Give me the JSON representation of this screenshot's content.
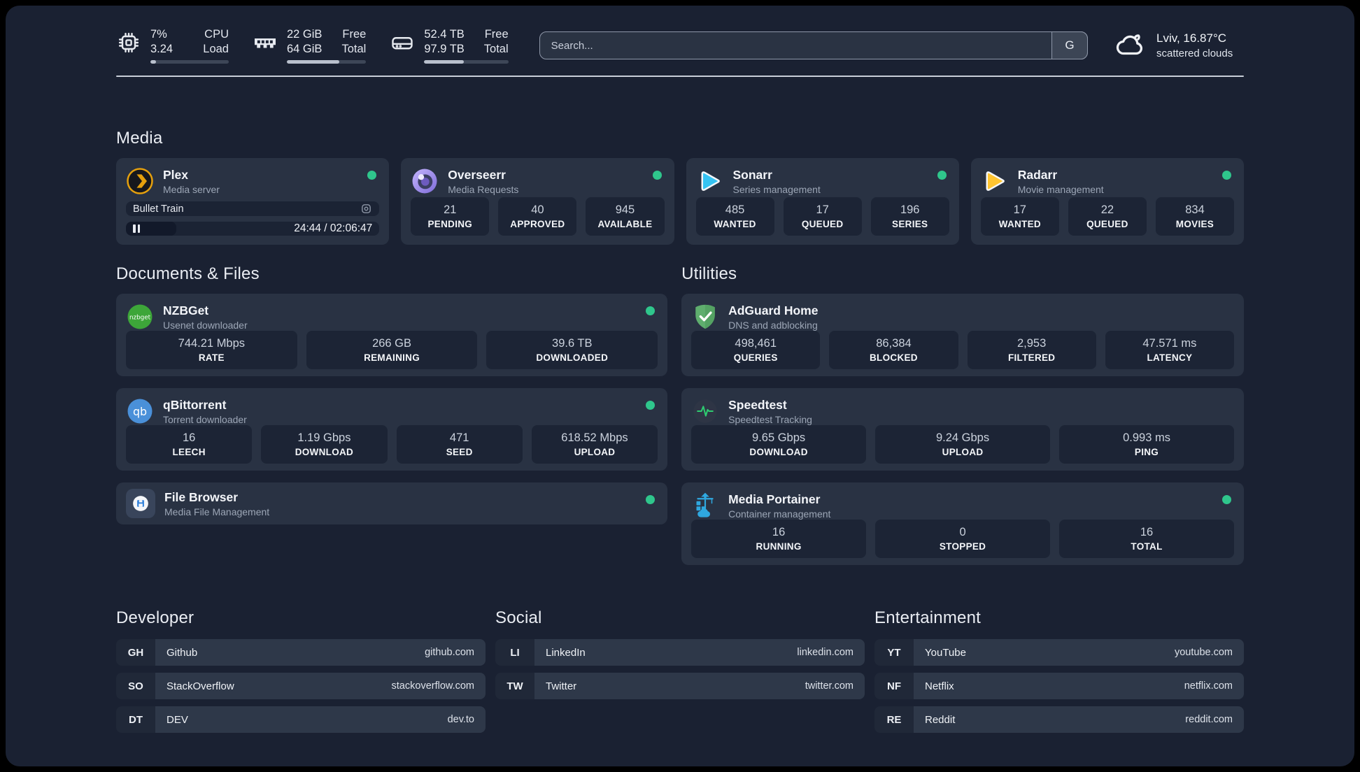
{
  "topbar": {
    "monitors": [
      {
        "icon": "cpu-icon",
        "value_top": "7%",
        "value_bottom": "3.24",
        "label_top": "CPU",
        "label_bottom": "Load",
        "progress_pct": 7
      },
      {
        "icon": "memory-icon",
        "value_top": "22 GiB",
        "value_bottom": "64 GiB",
        "label_top": "Free",
        "label_bottom": "Total",
        "progress_pct": 66
      },
      {
        "icon": "disk-icon",
        "value_top": "52.4 TB",
        "value_bottom": "97.9 TB",
        "label_top": "Free",
        "label_bottom": "Total",
        "progress_pct": 47
      }
    ],
    "search": {
      "placeholder": "Search...",
      "engine_button": "G"
    },
    "weather": {
      "icon": "cloud-icon",
      "title": "Lviv, 16.87°C",
      "subtitle": "scattered clouds"
    }
  },
  "sections": {
    "media": {
      "title": "Media",
      "plex": {
        "name": "Plex",
        "description": "Media server",
        "status": "online",
        "now_playing": "Bullet Train",
        "state": "paused",
        "time_display": "24:44 / 02:06:47",
        "progress_pct": 20
      },
      "overseerr": {
        "name": "Overseerr",
        "description": "Media Requests",
        "status": "online",
        "stats": [
          {
            "value": "21",
            "label": "PENDING"
          },
          {
            "value": "40",
            "label": "APPROVED"
          },
          {
            "value": "945",
            "label": "AVAILABLE"
          }
        ]
      },
      "sonarr": {
        "name": "Sonarr",
        "description": "Series management",
        "status": "online",
        "stats": [
          {
            "value": "485",
            "label": "WANTED"
          },
          {
            "value": "17",
            "label": "QUEUED"
          },
          {
            "value": "196",
            "label": "SERIES"
          }
        ]
      },
      "radarr": {
        "name": "Radarr",
        "description": "Movie management",
        "status": "online",
        "stats": [
          {
            "value": "17",
            "label": "WANTED"
          },
          {
            "value": "22",
            "label": "QUEUED"
          },
          {
            "value": "834",
            "label": "MOVIES"
          }
        ]
      }
    },
    "documents": {
      "title": "Documents & Files",
      "nzbget": {
        "name": "NZBGet",
        "description": "Usenet downloader",
        "status": "online",
        "stats": [
          {
            "value": "744.21 Mbps",
            "label": "RATE"
          },
          {
            "value": "266 GB",
            "label": "REMAINING"
          },
          {
            "value": "39.6 TB",
            "label": "DOWNLOADED"
          }
        ]
      },
      "qbittorrent": {
        "name": "qBittorrent",
        "description": "Torrent downloader",
        "status": "online",
        "stats": [
          {
            "value": "16",
            "label": "LEECH"
          },
          {
            "value": "1.19 Gbps",
            "label": "DOWNLOAD"
          },
          {
            "value": "471",
            "label": "SEED"
          },
          {
            "value": "618.52 Mbps",
            "label": "UPLOAD"
          }
        ]
      },
      "filebrowser": {
        "name": "File Browser",
        "description": "Media File Management",
        "status": "online"
      }
    },
    "utilities": {
      "title": "Utilities",
      "adguard": {
        "name": "AdGuard Home",
        "description": "DNS and adblocking",
        "stats": [
          {
            "value": "498,461",
            "label": "QUERIES"
          },
          {
            "value": "86,384",
            "label": "BLOCKED"
          },
          {
            "value": "2,953",
            "label": "FILTERED"
          },
          {
            "value": "47.571 ms",
            "label": "LATENCY"
          }
        ]
      },
      "speedtest": {
        "name": "Speedtest",
        "description": "Speedtest Tracking",
        "stats": [
          {
            "value": "9.65 Gbps",
            "label": "DOWNLOAD"
          },
          {
            "value": "9.24 Gbps",
            "label": "UPLOAD"
          },
          {
            "value": "0.993 ms",
            "label": "PING"
          }
        ]
      },
      "portainer": {
        "name": "Media Portainer",
        "description": "Container management",
        "status": "online",
        "stats": [
          {
            "value": "16",
            "label": "RUNNING"
          },
          {
            "value": "0",
            "label": "STOPPED"
          },
          {
            "value": "16",
            "label": "TOTAL"
          }
        ]
      }
    },
    "links": [
      {
        "title": "Developer",
        "items": [
          {
            "abbr": "GH",
            "name": "Github",
            "url": "github.com"
          },
          {
            "abbr": "SO",
            "name": "StackOverflow",
            "url": "stackoverflow.com"
          },
          {
            "abbr": "DT",
            "name": "DEV",
            "url": "dev.to"
          }
        ]
      },
      {
        "title": "Social",
        "items": [
          {
            "abbr": "LI",
            "name": "LinkedIn",
            "url": "linkedin.com"
          },
          {
            "abbr": "TW",
            "name": "Twitter",
            "url": "twitter.com"
          }
        ]
      },
      {
        "title": "Entertainment",
        "items": [
          {
            "abbr": "YT",
            "name": "YouTube",
            "url": "youtube.com"
          },
          {
            "abbr": "NF",
            "name": "Netflix",
            "url": "netflix.com"
          },
          {
            "abbr": "RE",
            "name": "Reddit",
            "url": "reddit.com"
          }
        ]
      }
    ]
  },
  "colors": {
    "status_online": "#2FC68C",
    "plex_accent": "#E5A00D",
    "background": "#1A2132",
    "card": "#293243"
  }
}
